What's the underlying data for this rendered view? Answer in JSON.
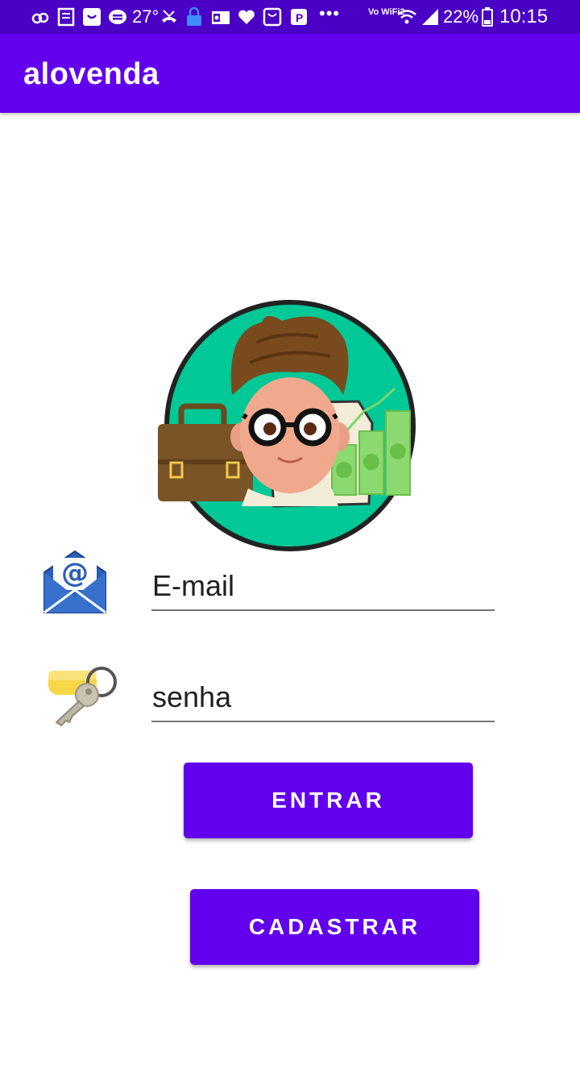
{
  "status_bar": {
    "temperature": "27°",
    "network": "Vo WiFi2",
    "battery": "22%",
    "time": "10:15",
    "more": "•••",
    "icons": [
      "weather-icon",
      "news-icon",
      "app-icon",
      "printer-icon",
      "missed-call-icon",
      "vpn-lock-icon",
      "outlook-icon",
      "heart-icon",
      "bag-icon",
      "parking-icon",
      "more-icon",
      "wifi-icon",
      "signal-icon",
      "battery-icon"
    ]
  },
  "app_bar": {
    "title": "alovenda"
  },
  "logo": {
    "icon": "salesman-avatar-icon"
  },
  "form": {
    "email": {
      "icon": "email-icon",
      "hint": "E-mail"
    },
    "password": {
      "icon": "key-icon",
      "hint": "senha"
    }
  },
  "buttons": {
    "login": "ENTRAR",
    "register": "CADASTRAR"
  },
  "colors": {
    "primary": "#6200ee",
    "status_bar": "#4a00c5",
    "avatar_circle": "#00c896",
    "underline": "#757575"
  }
}
